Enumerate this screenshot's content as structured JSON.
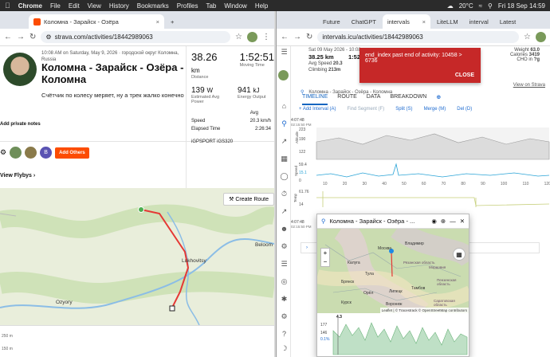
{
  "menubar": {
    "app": "Chrome",
    "items": [
      "File",
      "Edit",
      "View",
      "History",
      "Bookmarks",
      "Profiles",
      "Tab",
      "Window",
      "Help"
    ],
    "temp": "20°C",
    "clock": "Fri 18 Sep 14:59"
  },
  "left": {
    "tab_title": "Коломна - Зарайск - Озёра",
    "url": "strava.com/activities/18442989063",
    "meta": "10:08 AM on Saturday, May 9, 2026 · городской округ Коломна, Russia",
    "title": "Коломна - Зарайск - Озёра - Коломна",
    "description": "Счётчик по колесу меряет, ну а трек жалко конечно",
    "private_notes": "Add private notes",
    "distance_value": "38.26",
    "distance_unit": "km",
    "distance_label": "Distance",
    "moving_value": "1:52:51",
    "moving_label": "Moving Time",
    "power_value": "139",
    "power_unit": "W",
    "power_label": "Estimated Avg Power",
    "energy_value": "941",
    "energy_unit": "kJ",
    "energy_label": "Energy Output",
    "avg_header": "Avg",
    "speed_label": "Speed",
    "speed_value": "20.3 km/h",
    "elapsed_label": "Elapsed Time",
    "elapsed_value": "2:26:34",
    "device": "iGPSPORT iGS320",
    "avatar_b": "B",
    "add_others": "Add Others",
    "flybys": "View Flybys",
    "create_route": "Create Route",
    "map_labels": {
      "lukhovitsy": "Lukhovitsy",
      "ozyory": "Ozyory",
      "belo": "Beloom"
    },
    "elev_ticks": [
      "250 m",
      "150 m"
    ]
  },
  "right": {
    "tabs": [
      "Future",
      "ChatGPT",
      "intervals",
      "LiteLLM",
      "interval",
      "Latest"
    ],
    "url": "intervals.icu/activities/18442989063",
    "date": "Sat 09 May 2026 - 10:08",
    "distance": "38.25 km",
    "duration": "1:52:51",
    "avg_speed_label": "Avg Speed",
    "avg_speed": "20.3",
    "climbing_label": "Climbing",
    "climbing": "213m",
    "weight_label": "Weight",
    "weight": "63.0",
    "calories_label": "Calories",
    "calories": "3419",
    "cho_label": "CHO in",
    "cho": "?g",
    "alert_text": "end_index past end of activity: 10458 > 6736",
    "alert_close": "CLOSE",
    "title": "Коломна - Зарайск - Озёра - Коломна",
    "view_on_strava": "View on Strava",
    "tabs2": [
      "TIMELINE",
      "ROUTE",
      "DATA",
      "BREAKDOWN"
    ],
    "tools": [
      "+ Add Interval (A)",
      "Find Segment (F)",
      "Split (S)",
      "Merge (M)",
      "Del (D)"
    ],
    "time_top": "4:07:48",
    "time_top2": "02:15:50 PM",
    "alt_ticks": [
      "223",
      "190",
      "122"
    ],
    "alt_label": "Altitude",
    "speed_ticks": [
      "59.4",
      "15.1",
      "0"
    ],
    "speed_label": "Speed",
    "temp_ticks": [
      "61.76",
      "14"
    ],
    "temp_label": "Temp",
    "x_ticks": [
      "10",
      "20",
      "30",
      "40",
      "50",
      "60",
      "70",
      "80",
      "90",
      "100",
      "110",
      "120"
    ],
    "time_bottom": "4:07:48",
    "time_bottom2": "02:15:50 PM"
  },
  "popup": {
    "title": "Коломна - Зарайск - Озёра - ...",
    "cities": {
      "moskva": "Москва",
      "vladimir": "Владимир",
      "ryazan": "Рязанская область",
      "tula": "Тула",
      "orel": "Орёл",
      "voronezh": "Воронеж",
      "lipetsk": "Липецк",
      "penza": "Пензенская область",
      "saratov": "Саратовская область",
      "bryansk": "Брянск",
      "kursk": "Курск",
      "mordovia": "Мордовия",
      "kaluga": "Калуга",
      "tambov": "Тамбов"
    },
    "attribution": "Leaflet | © Tracestrack © OpenStreetMap contributors",
    "elev_ticks": [
      "177",
      "146",
      "0.1%"
    ],
    "elev_x": "4.3"
  }
}
